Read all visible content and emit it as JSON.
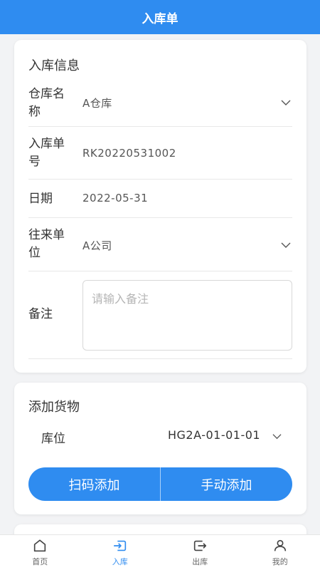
{
  "header": {
    "title": "入库单"
  },
  "info": {
    "title": "入库信息",
    "warehouse": {
      "label": "仓库名称",
      "value": "A仓库"
    },
    "order_no": {
      "label": "入库单号",
      "value": "RK20220531002"
    },
    "date": {
      "label": "日期",
      "value": "2022-05-31"
    },
    "partner": {
      "label": "往来单位",
      "value": "A公司"
    },
    "remark": {
      "label": "备注",
      "placeholder": "请输入备注",
      "value": ""
    }
  },
  "goods": {
    "title": "添加货物",
    "location": {
      "label": "库位",
      "value": "HG2A-01-01-01"
    },
    "scan_label": "扫码添加",
    "manual_label": "手动添加"
  },
  "tabbar": {
    "items": [
      {
        "label": "首页",
        "icon": "home-icon",
        "active": false
      },
      {
        "label": "入库",
        "icon": "inbound-icon",
        "active": true
      },
      {
        "label": "出库",
        "icon": "outbound-icon",
        "active": false
      },
      {
        "label": "我的",
        "icon": "profile-icon",
        "active": false
      }
    ]
  },
  "colors": {
    "primary": "#2f8cf0",
    "background": "#f2f3f5"
  }
}
